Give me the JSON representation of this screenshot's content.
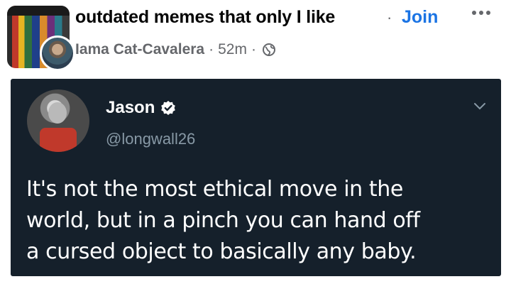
{
  "post": {
    "group_name": "outdated memes that only I like",
    "separator": "·",
    "join_label": "Join",
    "author": "Iama Cat-Cavalera",
    "time": "52m",
    "icons": {
      "more": "more-horizontal-icon",
      "privacy": "globe-icon"
    }
  },
  "tweet": {
    "name": "Jason",
    "handle": "@longwall26",
    "lines": [
      "It's not the most ethical move in the",
      "world, but in a pinch you can hand off",
      "a cursed object to basically any baby."
    ],
    "icons": {
      "verified": "verified-badge-icon",
      "menu": "chevron-down-icon"
    }
  },
  "colors": {
    "link": "#1b74e4",
    "meta_text": "#65676b",
    "tweet_bg": "#15202b",
    "tweet_handle": "#8899a6"
  }
}
